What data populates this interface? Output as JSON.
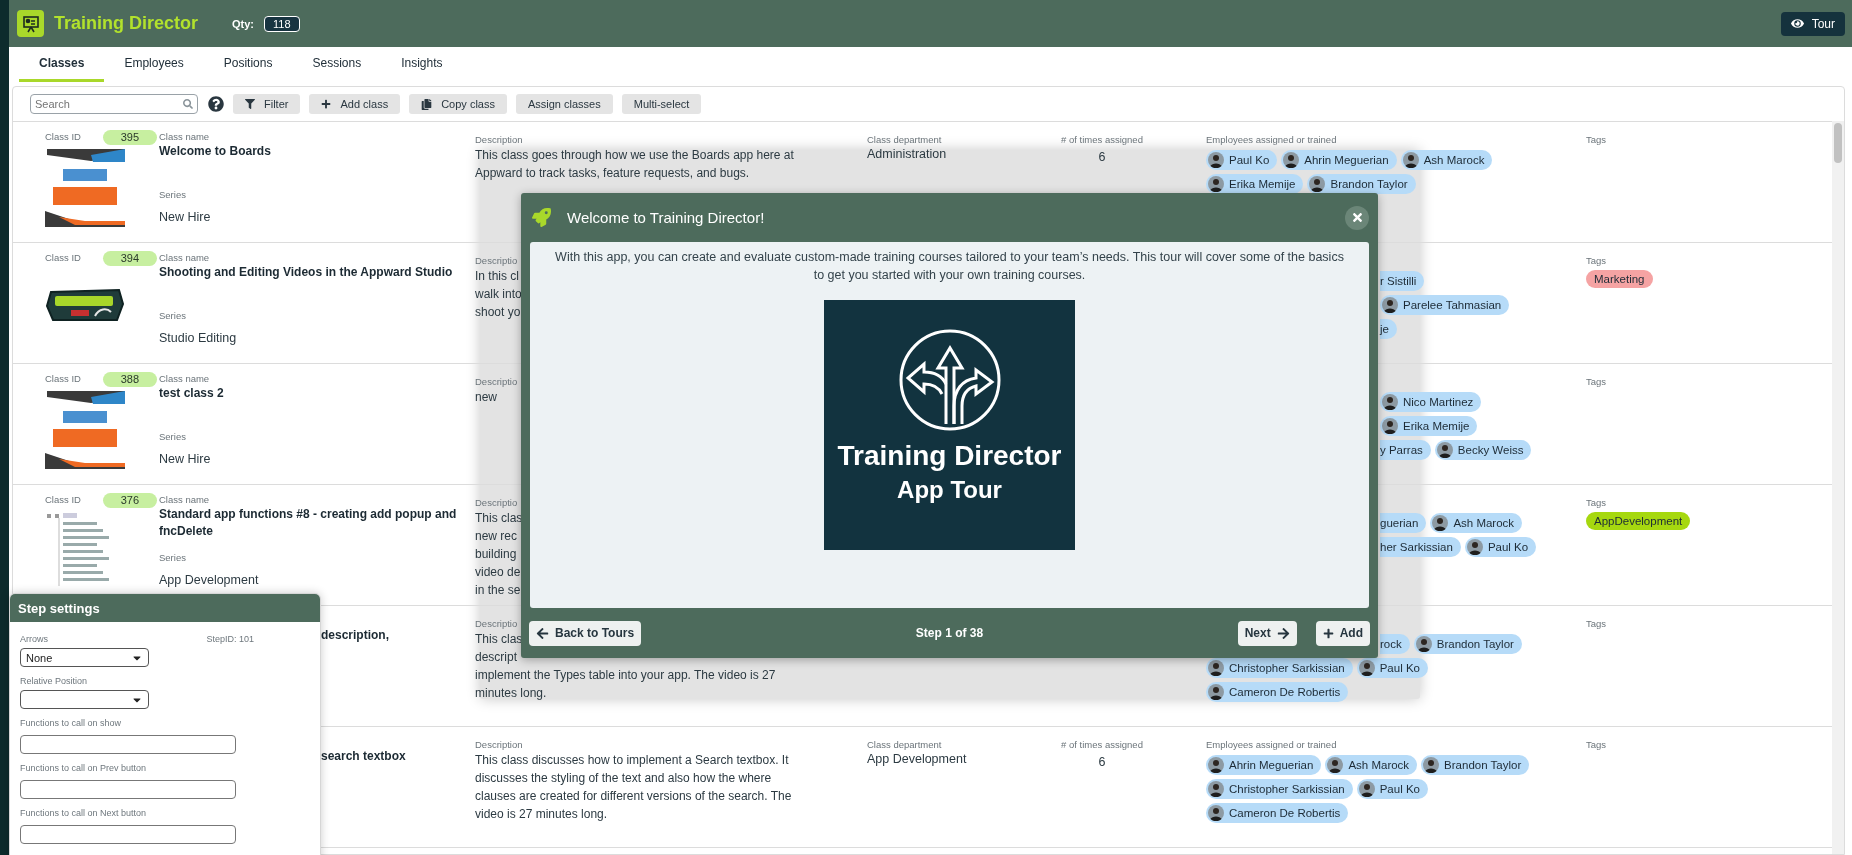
{
  "header": {
    "title": "Training Director",
    "qty_label": "Qty:",
    "qty": "118",
    "tour_button": "Tour"
  },
  "tabs": [
    {
      "label": "Classes",
      "selected": true
    },
    {
      "label": "Employees",
      "selected": false
    },
    {
      "label": "Positions",
      "selected": false
    },
    {
      "label": "Sessions",
      "selected": false
    },
    {
      "label": "Insights",
      "selected": false
    }
  ],
  "toolbar": {
    "search_placeholder": "Search",
    "buttons": [
      {
        "label": "Filter"
      },
      {
        "label": "Add class"
      },
      {
        "label": "Copy class"
      },
      {
        "label": "Assign classes"
      },
      {
        "label": "Multi-select"
      }
    ]
  },
  "rows": [
    {
      "class_id_label": "Class ID",
      "class_id": "395",
      "thumbnail": {
        "kind": "banner"
      },
      "class_name_label": "Class name",
      "class_name": "Welcome to Boards",
      "series_label": "Series",
      "series": "New Hire",
      "description_label": "Description",
      "description": [
        [
          "This class goes through how we use the Boards app here at",
          "Appward to track tasks, feature requests, and bugs."
        ]
      ],
      "department_label": "Class department",
      "department": "Administration",
      "times_label": "# of times assigned",
      "times": "6",
      "employees_label": "Employees assigned or trained",
      "employees": [
        {
          "chips": [
            {
              "kind": "person",
              "name": "Paul Ko"
            },
            {
              "kind": "person",
              "name": "Ahrin Meguerian"
            },
            {
              "kind": "person",
              "name": "Ash Marock"
            }
          ]
        },
        {
          "chips": [
            {
              "kind": "person",
              "name": "Erika Memije"
            },
            {
              "kind": "person",
              "name": "Brandon Taylor"
            }
          ]
        }
      ],
      "tags_label": "Tags"
    },
    {
      "class_id_label": "Class ID",
      "class_id": "394",
      "thumbnail": {
        "kind": "badge"
      },
      "class_name_label": "Class name",
      "class_name": "Shooting and Editing Videos in the Appward Studio",
      "series_label": "Series",
      "series": "Studio Editing",
      "description_label": "Descriptio",
      "description": [
        [
          "In this cl",
          "walk into",
          "shoot yo"
        ]
      ],
      "employees": [
        {
          "cut": true,
          "chips": [
            {
              "kind": "fragment",
              "name": "r Sistilli"
            }
          ]
        },
        {
          "cut": true,
          "chips": [
            {
              "kind": "person",
              "name": "Parelee Tahmasian"
            }
          ]
        },
        {
          "cut": true,
          "chips": [
            {
              "kind": "fragment",
              "name": "je"
            }
          ]
        }
      ],
      "tags_label": "Tags",
      "tags": [
        {
          "label": "Marketing",
          "color": "#f5a3a3"
        }
      ]
    },
    {
      "class_id_label": "Class ID",
      "class_id": "388",
      "thumbnail": {
        "kind": "banner"
      },
      "class_name_label": "Class name",
      "class_name": "test class 2",
      "series_label": "Series",
      "series": "New Hire",
      "description_label": "Descriptio",
      "description": [
        [
          "new"
        ]
      ],
      "employees": [
        {
          "cut": true,
          "chips": [
            {
              "kind": "person",
              "name": "Nico Martinez"
            }
          ]
        },
        {
          "cut": true,
          "chips": [
            {
              "kind": "person",
              "name": "Erika Memije"
            }
          ]
        },
        {
          "cut": true,
          "chips": [
            {
              "kind": "fragment",
              "name": "y Parras"
            },
            {
              "kind": "person",
              "name": "Becky Weiss"
            }
          ]
        }
      ],
      "tags_label": "Tags"
    },
    {
      "class_id_label": "Class ID",
      "class_id": "376",
      "thumbnail": {
        "kind": "tree"
      },
      "class_name_label": "Class name",
      "class_name": "Standard app functions #8 - creating add popup and fncDelete",
      "series_label": "Series",
      "series": "App Development",
      "description_label": "Descriptio",
      "description": [
        [
          "This clas",
          "new rec",
          "building",
          "video de",
          "in the se"
        ]
      ],
      "employees": [
        {
          "cut": true,
          "chips": [
            {
              "kind": "fragment",
              "name": "guerian"
            },
            {
              "kind": "person",
              "name": "Ash Marock"
            }
          ]
        },
        {
          "cut": true,
          "chips": [
            {
              "kind": "fragment",
              "name": "her Sarkissian"
            },
            {
              "kind": "person",
              "name": "Paul Ko"
            }
          ]
        }
      ],
      "tags_label": "Tags",
      "tags": [
        {
          "label": "AppDevelopment",
          "color": "#a6d80f"
        }
      ]
    },
    {
      "name_cut": true,
      "class_name": "description,",
      "description_label": "Descriptio",
      "description": [
        [
          "This clas",
          "descript"
        ],
        [
          "implement the Types table into your app.  The video is 27",
          "minutes long."
        ]
      ],
      "employees": [
        {
          "cut": true,
          "chips": [
            {
              "kind": "fragment",
              "name": "rock"
            },
            {
              "kind": "person",
              "name": "Brandon Taylor"
            }
          ]
        },
        {
          "chips": [
            {
              "kind": "person",
              "name": "Christopher Sarkissian"
            },
            {
              "kind": "person",
              "name": "Paul Ko"
            }
          ]
        },
        {
          "chips": [
            {
              "kind": "person",
              "name": "Cameron De Robertis"
            }
          ]
        }
      ],
      "tags_label": "Tags"
    },
    {
      "name_cut": true,
      "class_name": "search textbox",
      "description_label": "Description",
      "description": [
        [
          "This class discusses how to implement a Search textbox.  It",
          "discusses the styling of the text and also how the where",
          "clauses are created for different versions of the search.  The",
          "video is 27 minutes long."
        ]
      ],
      "department_label": "Class department",
      "department": "App Development",
      "times_label": "# of times assigned",
      "times": "6",
      "employees_label": "Employees assigned or trained",
      "employees": [
        {
          "chips": [
            {
              "kind": "person",
              "name": "Ahrin Meguerian"
            },
            {
              "kind": "person",
              "name": "Ash Marock"
            },
            {
              "kind": "person",
              "name": "Brandon Taylor"
            }
          ]
        },
        {
          "chips": [
            {
              "kind": "person",
              "name": "Christopher Sarkissian"
            },
            {
              "kind": "person",
              "name": "Paul Ko"
            }
          ]
        },
        {
          "chips": [
            {
              "kind": "person",
              "name": "Cameron De Robertis"
            }
          ]
        }
      ],
      "tags_label": "Tags"
    }
  ],
  "tour_modal": {
    "title": "Welcome to Training Director!",
    "text": "With this app, you can create and evaluate custom-made training courses tailored to your team’s needs. This tour will cover some of the basics to get you started with your own training courses.",
    "cover_title": "Training Director",
    "cover_subtitle": "App Tour",
    "back_button": "Back to Tours",
    "step": "Step 1 of 38",
    "next_button": "Next",
    "add_button": "Add"
  },
  "step_settings": {
    "title": "Step settings",
    "step_id": "StepID: 101",
    "fields": [
      {
        "label": "Arrows",
        "kind": "select",
        "value": "None"
      },
      {
        "label": "Relative Position",
        "kind": "select"
      },
      {
        "label": "Functions to call on show",
        "kind": "text"
      },
      {
        "label": "Functions to call on Prev button",
        "kind": "text"
      },
      {
        "label": "Functions to call on Next button",
        "kind": "text"
      }
    ]
  }
}
